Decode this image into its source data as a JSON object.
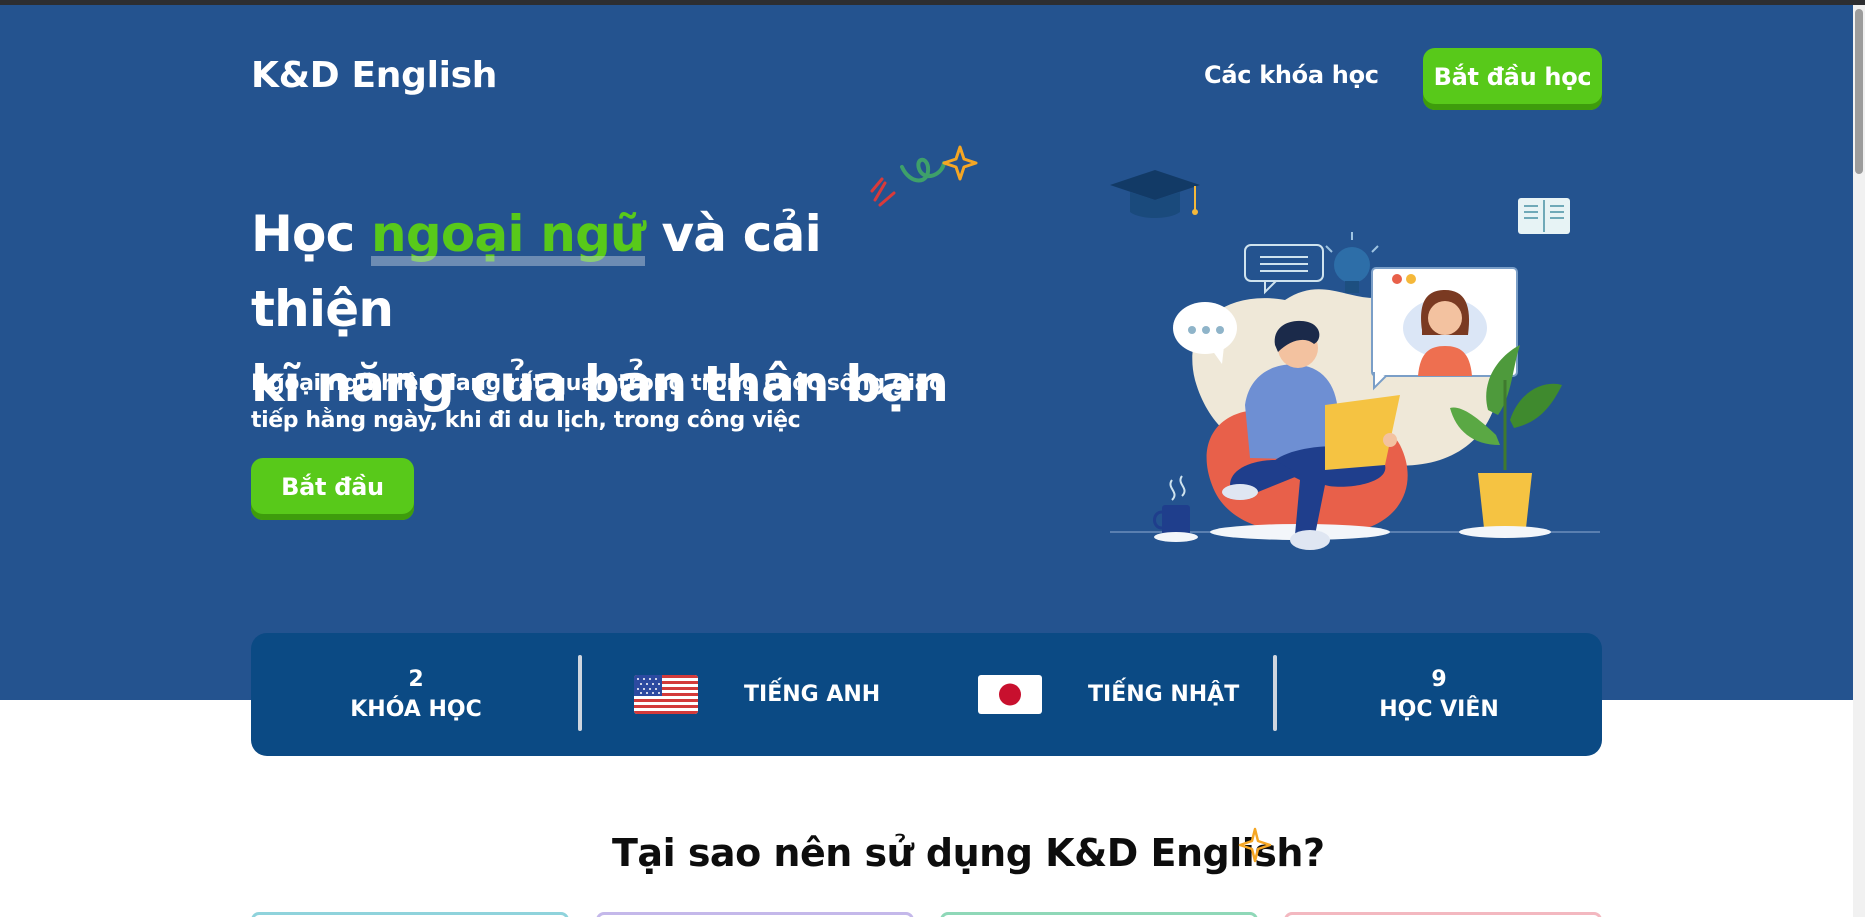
{
  "header": {
    "logo": "K&D English",
    "nav_link": "Các khóa học",
    "nav_cta": "Bắt đầu học"
  },
  "hero": {
    "title_part1": "Học ",
    "title_highlight": "ngoại ngữ",
    "title_part2": " và cải thiện",
    "title_line2": "kĩ năng của bản thân bạn",
    "subtext_line1": "Ngoại ngữ hiện đang rất quan trọng trong cuộc sống giao",
    "subtext_line2": "tiếp hằng ngày, khi đi du lịch, trong công việc",
    "cta": "Bắt đầu"
  },
  "stats": {
    "courses_count": "2",
    "courses_label": "KHÓA HỌC",
    "lang_english": "TIẾNG ANH",
    "lang_japanese": "TIẾNG NHẬT",
    "students_count": "9",
    "students_label": "HỌC VIÊN"
  },
  "why": {
    "title": "Tại sao nên sử dụng K&D English?"
  },
  "colors": {
    "hero_bg": "#24538f",
    "stats_bg": "#0b4a84",
    "accent_green": "#58c91a",
    "spark_orange": "#f5a623"
  },
  "card_borders": [
    "#8fd3dc",
    "#c4b8ea",
    "#8fd8b8",
    "#f3b8c0"
  ]
}
